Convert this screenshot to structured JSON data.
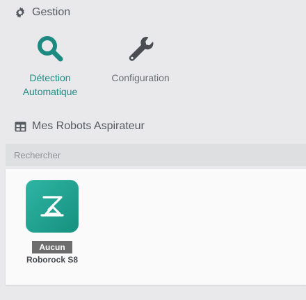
{
  "gestion": {
    "title": "Gestion",
    "icon": "gear-icon",
    "actions": [
      {
        "label_line1": "Détection",
        "label_line2": "Automatique",
        "icon": "search-icon",
        "color": "#1d8a82"
      },
      {
        "label_line1": "Configuration",
        "icon": "wrench-icon",
        "color": "#4a4e53"
      }
    ]
  },
  "robots": {
    "title": "Mes Robots Aspirateur",
    "icon": "table-icon",
    "search": {
      "placeholder": "Rechercher"
    },
    "items": [
      {
        "name": "Roborock S8",
        "status": "Aucun",
        "icon": "roborock-logo",
        "color": "#1d9d8c"
      }
    ]
  }
}
